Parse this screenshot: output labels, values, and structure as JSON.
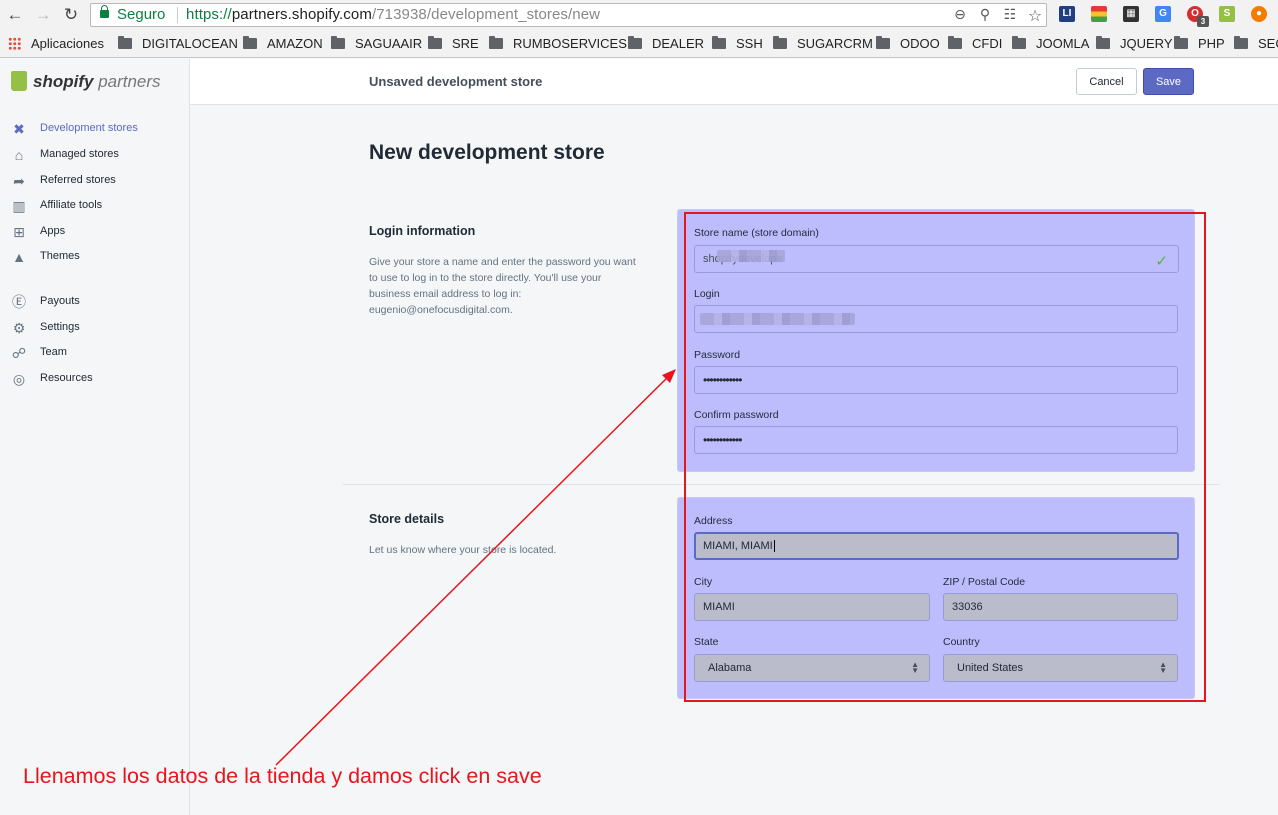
{
  "browser": {
    "secure_label": "Seguro",
    "url_scheme": "https://",
    "url_host": "partners.shopify.com",
    "url_path": "/713938/development_stores/new",
    "bookmarks": [
      "Aplicaciones",
      "DIGITALOCEAN",
      "AMAZON",
      "SAGUAAIR",
      "SRE",
      "RUMBOSERVICES",
      "DEALER",
      "SSH",
      "SUGARCRM",
      "ODOO",
      "CFDI",
      "JOOMLA",
      "JQUERY",
      "PHP",
      "SEC"
    ],
    "extension_badge": "3"
  },
  "brand": {
    "logo_bold": "shopify",
    "logo_light": "partners"
  },
  "sidebar": {
    "items": [
      {
        "label": "Development stores",
        "icon": "tools-icon",
        "active": true
      },
      {
        "label": "Managed stores",
        "icon": "store-icon"
      },
      {
        "label": "Referred stores",
        "icon": "referral-icon"
      },
      {
        "label": "Affiliate tools",
        "icon": "chart-icon"
      },
      {
        "label": "Apps",
        "icon": "apps-icon"
      },
      {
        "label": "Themes",
        "icon": "themes-icon"
      },
      {
        "label": "Payouts",
        "icon": "dollar-icon"
      },
      {
        "label": "Settings",
        "icon": "gear-icon"
      },
      {
        "label": "Team",
        "icon": "team-icon"
      },
      {
        "label": "Resources",
        "icon": "lifebuoy-icon"
      }
    ]
  },
  "header": {
    "title": "Unsaved development store",
    "cancel_label": "Cancel",
    "save_label": "Save"
  },
  "page": {
    "title": "New development store"
  },
  "login_section": {
    "title": "Login information",
    "description": "Give your store a name and enter the password you want to use to log in to the store directly. You'll use your business email address to log in: eugenio@onefocusdigital.com.",
    "store_name_label": "Store name (store domain)",
    "store_name_value": "shopifydevelope",
    "login_label": "Login",
    "password_label": "Password",
    "password_value": "••••••••••••",
    "confirm_password_label": "Confirm password",
    "confirm_password_value": "••••••••••••"
  },
  "store_section": {
    "title": "Store details",
    "description": "Let us know where your store is located.",
    "address_label": "Address",
    "address_value": "MIAMI, MIAMI",
    "city_label": "City",
    "city_value": "MIAMI",
    "zip_label": "ZIP / Postal Code",
    "zip_value": "33036",
    "state_label": "State",
    "state_value": "Alabama",
    "country_label": "Country",
    "country_value": "United States"
  },
  "annotation": {
    "text": "Llenamos los datos de la tienda y damos click en save",
    "color": "#e8151c"
  },
  "colors": {
    "accent": "#5c6ac4",
    "highlight": "#bdbdfd",
    "annotation": "#e8151c"
  }
}
